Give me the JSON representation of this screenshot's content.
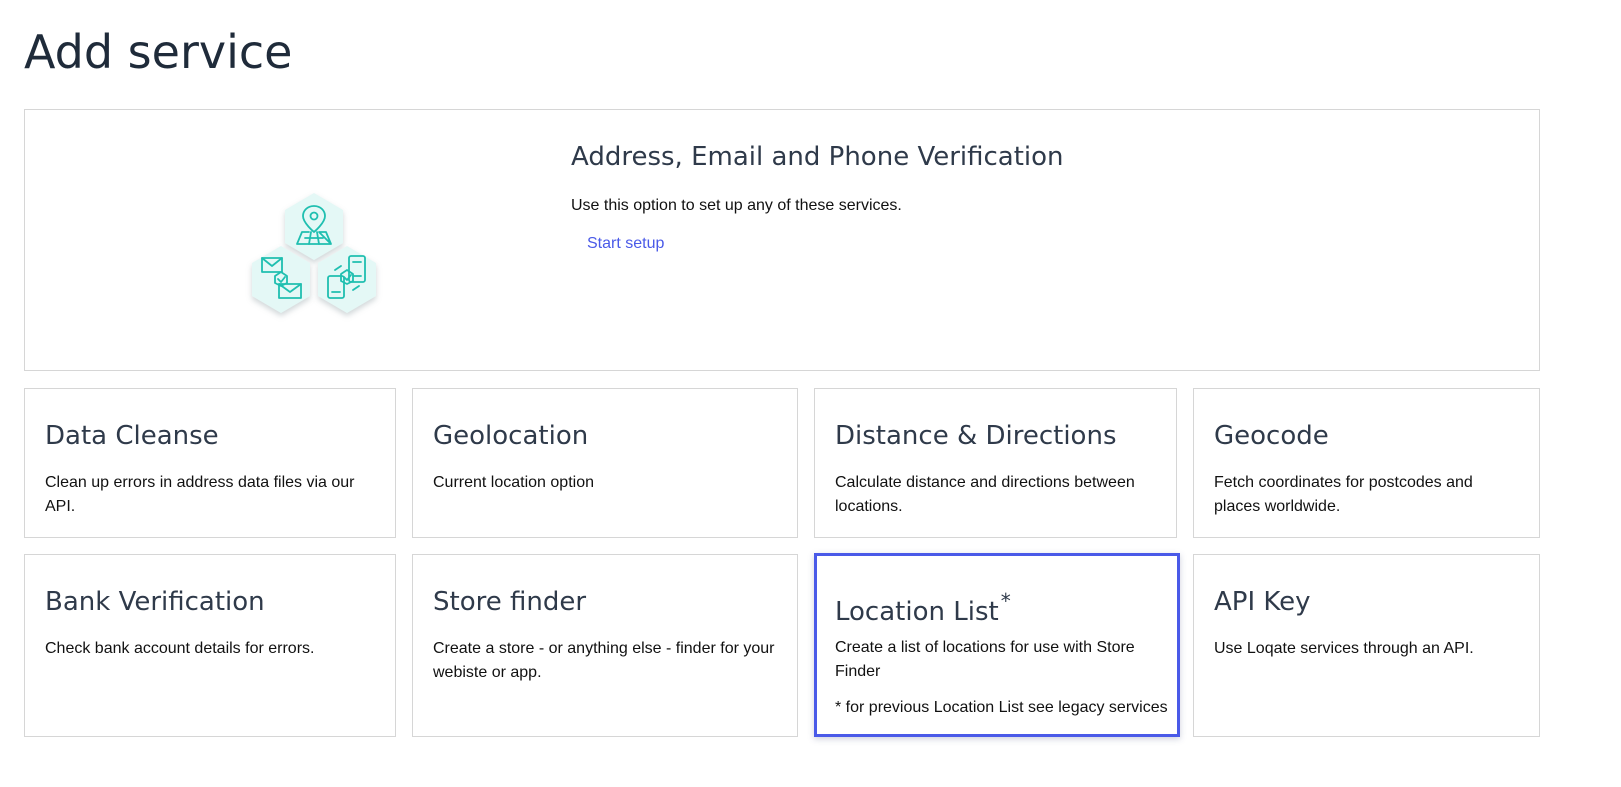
{
  "page": {
    "title": "Add service"
  },
  "hero": {
    "title": "Address, Email and Phone Verification",
    "description": "Use this option to set up any of these services.",
    "link_label": "Start setup",
    "icons": [
      "map-pin-icon",
      "email-icon",
      "phone-icon"
    ]
  },
  "services": {
    "data_cleanse": {
      "title": "Data Cleanse",
      "description": "Clean up errors in address data files via our API."
    },
    "geolocation": {
      "title": "Geolocation",
      "description": "Current location option"
    },
    "distance_directions": {
      "title": "Distance & Directions",
      "description": "Calculate distance and directions between locations."
    },
    "geocode": {
      "title": "Geocode",
      "description": "Fetch coordinates for postcodes and places worldwide."
    },
    "bank_verification": {
      "title": "Bank Verification",
      "description": "Check bank account details for errors."
    },
    "store_finder": {
      "title": "Store finder",
      "description": "Create a store - or anything else - finder for your webiste or app."
    },
    "location_list": {
      "title": "Location List",
      "asterisk": "*",
      "description": "Create a list of locations for use with Store Finder",
      "note": "* for previous Location List see legacy services",
      "selected": true
    },
    "api_key": {
      "title": "API Key",
      "description": "Use Loqate services through an API."
    }
  },
  "colors": {
    "accent": "#4a5ae8",
    "icon_stroke": "#1fbfb0",
    "icon_fill": "#e4f8f6",
    "border": "#d6d6d6",
    "heading": "#2f3a4a"
  }
}
